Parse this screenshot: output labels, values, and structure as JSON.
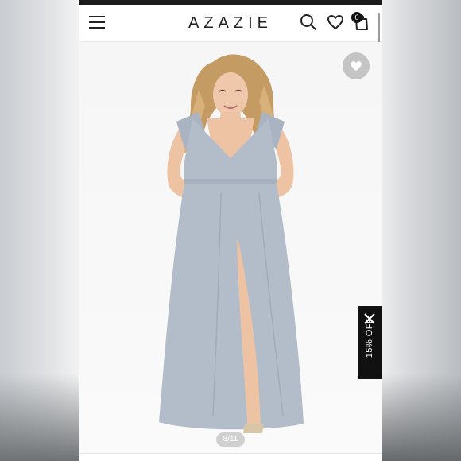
{
  "header": {
    "brand": "AZAZIE",
    "bag_count": "0"
  },
  "icons": {
    "menu": "menu-icon",
    "search": "search-icon",
    "wishlist": "heart-icon",
    "bag": "shopping-bag-icon",
    "favorite": "heart-icon",
    "close": "close-icon"
  },
  "product": {
    "image_label": "Model wearing dusty blue chiffon maxi dress with flutter sleeves and front slit",
    "gallery_counter": "8/11"
  },
  "promo": {
    "label": "15% OFF"
  },
  "colors": {
    "dress": "#b3bcc9",
    "header_text": "#222222",
    "promo_bg": "#111111"
  }
}
